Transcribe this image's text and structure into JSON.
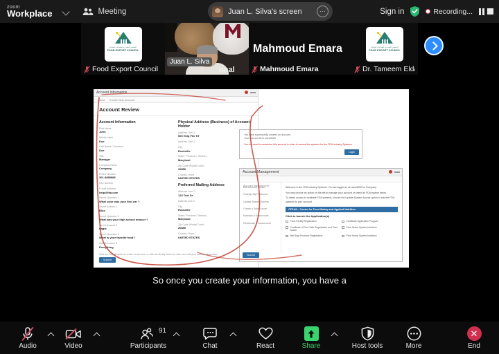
{
  "app": {
    "brand_small": "zoom",
    "brand_large": "Workplace",
    "meeting_label": "Meeting",
    "menu_icon": "people-icon",
    "chevron_icon": "chevron-down-icon"
  },
  "header": {
    "shared_screen_label": "Juan L. Silva's screen",
    "more_options_icon": "ellipsis-icon",
    "sign_in": "Sign in",
    "encryption_icon": "shield-check-icon",
    "recording_label": "Recording...",
    "recording_dot_icon": "record-dot-icon",
    "pause_icon": "pause-icon",
    "stop_icon": "stop-icon"
  },
  "filmstrip": {
    "next_icon": "chevron-right-icon",
    "participants": [
      {
        "name": "Food Export Council",
        "muted": true,
        "active_speaker": false,
        "avatar_type": "logo",
        "logo_arabic": "المجلس التصديري للصناعات الغذائية",
        "logo_english": "FOOD EXPORT COUNCIL"
      },
      {
        "name": "Juan L. Silva",
        "muted": false,
        "active_speaker": true,
        "avatar_type": "video",
        "overlay_text": "onal"
      },
      {
        "name": "Mahmoud Emara",
        "muted": true,
        "active_speaker": false,
        "avatar_type": "name-only"
      },
      {
        "name": "Dr. Tameem Eldawy",
        "muted": true,
        "active_speaker": false,
        "avatar_type": "logo",
        "logo_arabic": "المجلس التصديري للصناعات الغذائية",
        "logo_english": "FOOD EXPORT COUNCIL"
      }
    ]
  },
  "shared_screen": {
    "caption": "So once you create your information, you have a",
    "window_account_information": {
      "title": "Account Information",
      "breadcrumbs": [
        "Home",
        "Create New Account"
      ],
      "page_heading": "Account Review",
      "left_column": {
        "section_title": "Account Information",
        "fields": [
          {
            "label": "First Name",
            "value": "John"
          },
          {
            "label": "Middle Initial",
            "value": "Doe"
          },
          {
            "label": "Last Name / Surname",
            "value": "Doe"
          },
          {
            "label": "Title",
            "value": "Manager"
          },
          {
            "label": "Company Name",
            "value": "Company"
          },
          {
            "label": "Phone Number",
            "value": "301-8888888"
          },
          {
            "label": "FAX Number",
            "value": ""
          },
          {
            "label": "E-mail Address",
            "value": "help@fda.com"
          },
          {
            "label": "Secret Question 1",
            "value": "What color was your first car ?"
          },
          {
            "label": "Secret Answer 1",
            "value": "Blue"
          },
          {
            "label": "Secret Question 2",
            "value": "What was your high school mascot ?"
          },
          {
            "label": "Secret Answer 2",
            "value": "Eagle"
          },
          {
            "label": "Secret Question 3",
            "value": "What is your favorite food?"
          },
          {
            "label": "Secret Answer 3",
            "value": "Everything"
          }
        ]
      },
      "right_column": {
        "section_title": "Physical Address (Business) of Account Holder",
        "fields": [
          {
            "label": "Address Line 1",
            "value": "500 Help File ST"
          },
          {
            "label": "Address Line 2",
            "value": ""
          },
          {
            "label": "City",
            "value": "Rockville"
          },
          {
            "label": "State / Province / Territory",
            "value": "Maryland"
          },
          {
            "label": "Zip Code (Postal Code)",
            "value": "20850"
          },
          {
            "label": "Country / Area",
            "value": "UNITED STATES"
          }
        ],
        "section_title_2": "Preferred Mailing Address",
        "fields_2": [
          {
            "label": "Address Line 1",
            "value": "123 Test Dr"
          },
          {
            "label": "Address Line 2",
            "value": ""
          },
          {
            "label": "City",
            "value": "Rockville"
          },
          {
            "label": "State / Province / Territory",
            "value": "Maryland"
          },
          {
            "label": "Zip Code (Postal Code)",
            "value": "20850"
          },
          {
            "label": "Country / Area",
            "value": "UNITED STATES"
          }
        ]
      },
      "footnote": "Click the Submit button to create an account, or click the Modify button to return and edit your account information.",
      "submit_button": "Submit"
    },
    "window_message": {
      "line1": "You have successfully created an account.",
      "line2": "Your account ID is userid000",
      "warning": "You will need to remember this account in order to access the systems for the FDA Industry Systems.",
      "ok_button": "Login"
    },
    "window_account_management": {
      "title": "Account Management",
      "breadcrumb": "Account Management",
      "nav_items": [
        "Edit Account Profile",
        "Change My Password",
        "Update System Access",
        "Create a Subaccount",
        "Maintain a Subaccount",
        "Reactivate a Subaccount"
      ],
      "intro_line1": "Welcome to the FDA Industry Systems. You are logged in as userid000 for Company.",
      "intro_line2": "You may choose an option on the left to manage your account or select an FDA system below.",
      "intro_line3": "To obtain access to available FDA systems, choose the Update System Access option to add the FDA systems to your account.",
      "blue_bar": "CFSAN - Center for Food Safety and Applied Nutrition",
      "sub_heading": "Click to launch the Application(s)",
      "options": [
        "Food Facility Registration",
        "Certificate Application Program",
        "Certificate of Free Sale Registration and Prior Notice",
        "Prior Notice System Interface",
        "Mail Bag Producer Registration",
        "Prior Notice System Interface"
      ],
      "submit_button": "Submit"
    }
  },
  "toolbar": {
    "items": [
      {
        "label": "Audio",
        "icon": "microphone-muted-icon",
        "has_caret": true,
        "state": "muted"
      },
      {
        "label": "Video",
        "icon": "camera-muted-icon",
        "has_caret": true,
        "state": "muted"
      },
      {
        "label": "Participants",
        "icon": "participants-icon",
        "has_caret": true,
        "badge": "91"
      },
      {
        "label": "Chat",
        "icon": "chat-bubble-icon",
        "has_caret": true
      },
      {
        "label": "React",
        "icon": "heart-icon",
        "has_caret": false
      },
      {
        "label": "Share",
        "icon": "share-screen-icon",
        "has_caret": true,
        "state": "active"
      },
      {
        "label": "Host tools",
        "icon": "shield-icon",
        "has_caret": false
      },
      {
        "label": "More",
        "icon": "ellipsis-circle-icon",
        "has_caret": false
      },
      {
        "label": "End",
        "icon": "end-call-icon",
        "has_caret": false
      }
    ]
  },
  "colors": {
    "accent_green": "#39d46e",
    "active_speaker_border": "#49d66a",
    "end_red": "#d0304d",
    "next_blue": "#2d8cff",
    "toolbar_bg": "#0c0c0c",
    "topbar_bg": "#1a1a1a"
  }
}
